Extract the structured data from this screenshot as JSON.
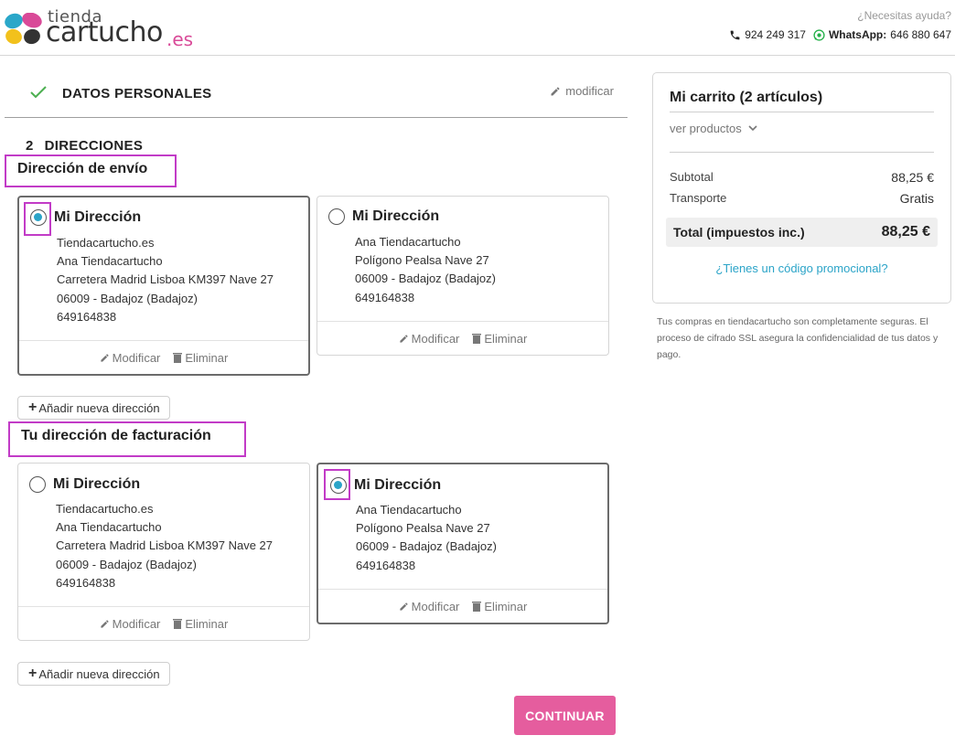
{
  "header": {
    "logo": {
      "small": "tienda",
      "main": "cartucho",
      "suffix": ".es"
    },
    "help_text": "¿Necesitas ayuda?",
    "phone": "924 249 317",
    "whatsapp_label": "WhatsApp:",
    "whatsapp_number": "646 880 647"
  },
  "step1": {
    "title": "DATOS PERSONALES",
    "modify_label": "modificar"
  },
  "step2": {
    "number": "2",
    "title": "DIRECCIONES"
  },
  "shipping": {
    "label": "Dirección de envío",
    "addresses": [
      {
        "alias": "Mi Dirección",
        "selected": true,
        "lines": [
          "Tiendacartucho.es",
          "Ana Tiendacartucho",
          "Carretera Madrid Lisboa KM397 Nave 27",
          "06009 - Badajoz (Badajoz)",
          "649164838"
        ],
        "edit": "Modificar",
        "delete": "Eliminar"
      },
      {
        "alias": "Mi Dirección",
        "selected": false,
        "lines": [
          "Ana Tiendacartucho",
          "Polígono Pealsa Nave 27",
          "06009 - Badajoz (Badajoz)",
          "649164838"
        ],
        "edit": "Modificar",
        "delete": "Eliminar"
      }
    ],
    "add_label": "Añadir nueva dirección"
  },
  "billing": {
    "label": "Tu dirección de facturación",
    "addresses": [
      {
        "alias": "Mi Dirección",
        "selected": false,
        "lines": [
          "Tiendacartucho.es",
          "Ana Tiendacartucho",
          "Carretera Madrid Lisboa KM397 Nave 27",
          "06009 - Badajoz (Badajoz)",
          "649164838"
        ],
        "edit": "Modificar",
        "delete": "Eliminar"
      },
      {
        "alias": "Mi Dirección",
        "selected": true,
        "lines": [
          "Ana Tiendacartucho",
          "Polígono Pealsa Nave 27",
          "06009 - Badajoz (Badajoz)",
          "649164838"
        ],
        "edit": "Modificar",
        "delete": "Eliminar"
      }
    ],
    "add_label": "Añadir nueva dirección"
  },
  "continue_label": "CONTINUAR",
  "cart": {
    "title": "Mi carrito (2 artículos)",
    "view_products": "ver productos",
    "subtotal_label": "Subtotal",
    "subtotal_value": "88,25 €",
    "shipping_label": "Transporte",
    "shipping_value": "Gratis",
    "total_label": "Total (impuestos inc.)",
    "total_value": "88,25 €",
    "promo_link": "¿Tienes un código promocional?"
  },
  "secure_text": "Tus compras en tiendacartucho son completamente seguras. El proceso de cifrado SSL asegura la confidencialidad de tus datos y pago.",
  "colors": {
    "accent_pink": "#e55d9e",
    "radio_blue": "#2ba4c8",
    "highlight": "#c23bc7"
  }
}
